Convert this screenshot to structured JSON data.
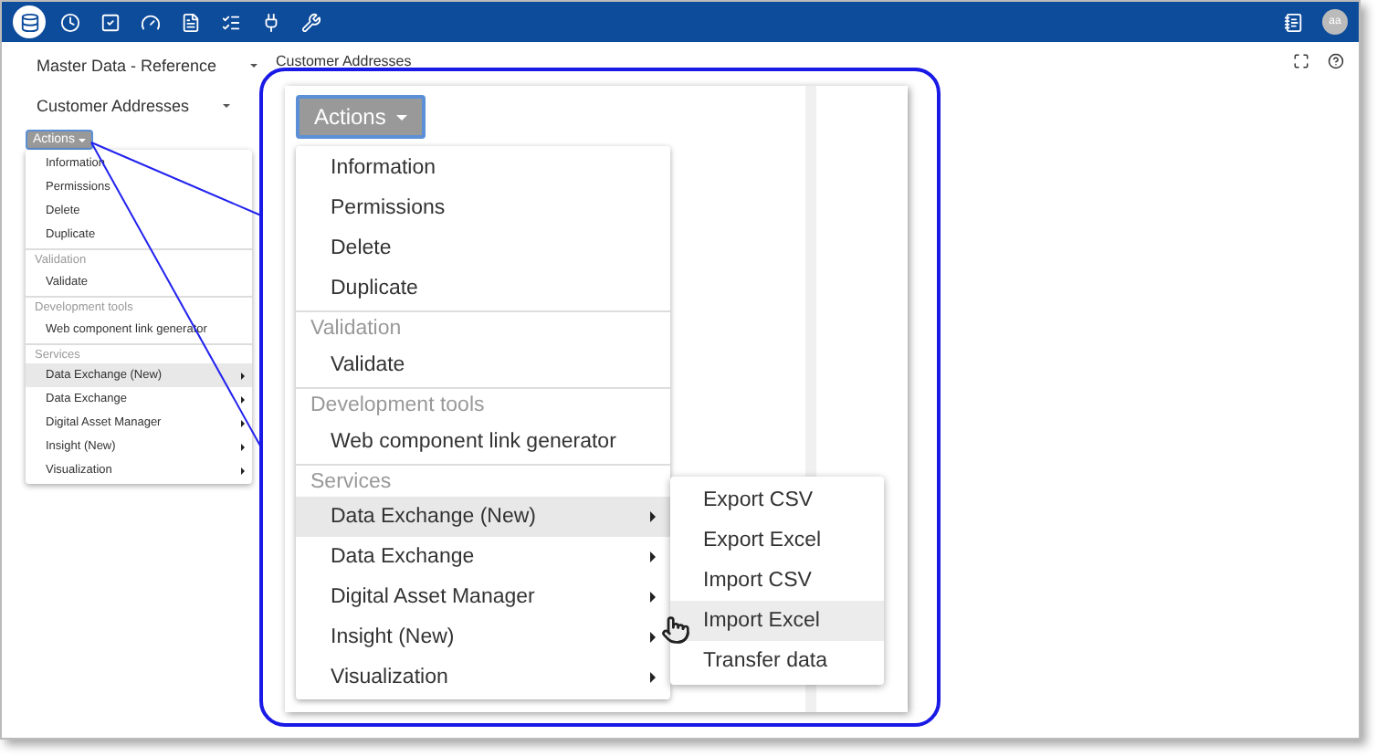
{
  "app_bar": {
    "nav_icons": [
      {
        "selected": true
      },
      {
        "selected": false
      },
      {
        "selected": false
      },
      {
        "selected": false
      },
      {
        "selected": false
      },
      {
        "selected": false
      },
      {
        "selected": false
      },
      {
        "selected": false
      }
    ],
    "avatar": "aa"
  },
  "header": {
    "title": "Master Data - Reference",
    "page_title": "Customer Addresses"
  },
  "sidebar": {
    "view": "Customer Addresses",
    "actions_button": "Actions",
    "menu": [
      {
        "items": [
          {
            "label": "Information",
            "has_submenu": false,
            "selected": false
          },
          {
            "label": "Permissions",
            "has_submenu": false,
            "selected": false
          },
          {
            "label": "Delete",
            "has_submenu": false,
            "selected": false
          },
          {
            "label": "Duplicate",
            "has_submenu": false,
            "selected": false
          }
        ]
      },
      {
        "heading": "Validation",
        "items": [
          {
            "label": "Validate",
            "has_submenu": false,
            "selected": false
          }
        ]
      },
      {
        "heading": "Development tools",
        "items": [
          {
            "label": "Web component link generator",
            "has_submenu": false,
            "selected": false
          }
        ]
      },
      {
        "heading": "Services",
        "items": [
          {
            "label": "Data Exchange (New)",
            "has_submenu": true,
            "selected": true
          },
          {
            "label": "Data Exchange",
            "has_submenu": true,
            "selected": false
          },
          {
            "label": "Digital Asset Manager",
            "has_submenu": true,
            "selected": false
          },
          {
            "label": "Insight (New)",
            "has_submenu": true,
            "selected": false
          },
          {
            "label": "Visualization",
            "has_submenu": true,
            "selected": false
          }
        ]
      }
    ]
  },
  "callout": {
    "actions_button": "Actions",
    "menu": [
      {
        "items": [
          {
            "label": "Information",
            "has_submenu": false,
            "selected": false
          },
          {
            "label": "Permissions",
            "has_submenu": false,
            "selected": false
          },
          {
            "label": "Delete",
            "has_submenu": false,
            "selected": false
          },
          {
            "label": "Duplicate",
            "has_submenu": false,
            "selected": false
          }
        ]
      },
      {
        "heading": "Validation",
        "items": [
          {
            "label": "Validate",
            "has_submenu": false,
            "selected": false
          }
        ]
      },
      {
        "heading": "Development tools",
        "items": [
          {
            "label": "Web component link generator",
            "has_submenu": false,
            "selected": false
          }
        ]
      },
      {
        "heading": "Services",
        "items": [
          {
            "label": "Data Exchange (New)",
            "has_submenu": true,
            "selected": true
          },
          {
            "label": "Data Exchange",
            "has_submenu": true,
            "selected": false
          },
          {
            "label": "Digital Asset Manager",
            "has_submenu": true,
            "selected": false
          },
          {
            "label": "Insight (New)",
            "has_submenu": true,
            "selected": false
          },
          {
            "label": "Visualization",
            "has_submenu": true,
            "selected": false
          }
        ]
      }
    ],
    "submenu": [
      {
        "label": "Export CSV",
        "selected": false
      },
      {
        "label": "Export Excel",
        "selected": false
      },
      {
        "label": "Import CSV",
        "selected": false
      },
      {
        "label": "Import Excel",
        "selected": true
      },
      {
        "label": "Transfer data",
        "selected": false
      }
    ]
  }
}
